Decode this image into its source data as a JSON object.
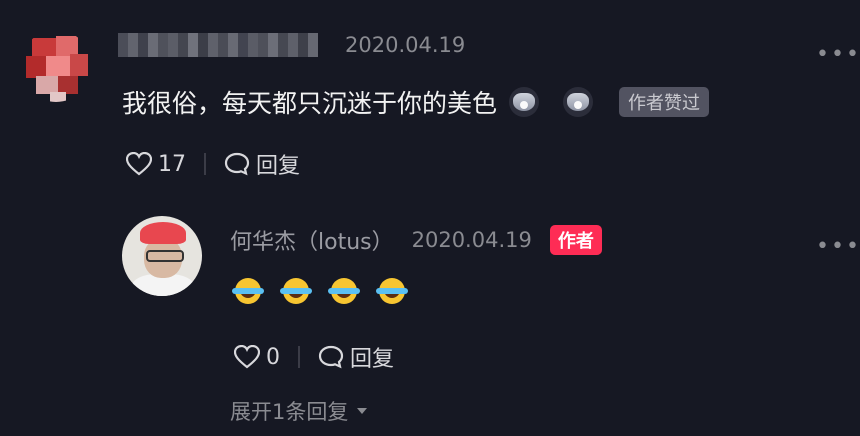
{
  "comment": {
    "date": "2020.04.19",
    "text": "我很俗，每天都只沉迷于你的美色",
    "author_liked_badge": "作者赞过",
    "like_count": "17",
    "reply_label": "回复",
    "more_icon": "more-dots-icon"
  },
  "reply": {
    "author_name": "何华杰（lotus）",
    "date": "2020.04.19",
    "author_badge": "作者",
    "like_count": "0",
    "reply_label": "回复",
    "more_icon": "more-dots-icon"
  },
  "expand_label": "展开1条回复",
  "colors": {
    "background": "#161823",
    "author_badge": "#fe2c55",
    "muted_text": "#8a8b91"
  }
}
